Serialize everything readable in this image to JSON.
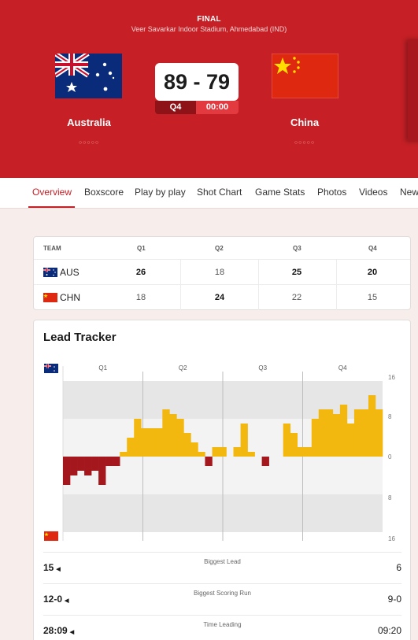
{
  "header": {
    "stage": "FINAL",
    "venue": "Veer Savarkar Indoor Stadium, Ahmedabad (IND)",
    "home_team": "Australia",
    "away_team": "China",
    "score": "89 - 79",
    "period": "Q4",
    "clock": "00:00",
    "dots": "○○○○○"
  },
  "tabs": [
    "Overview",
    "Boxscore",
    "Play by play",
    "Shot Chart",
    "Game Stats",
    "Photos",
    "Videos",
    "New"
  ],
  "quarters": {
    "headers": [
      "TEAM",
      "Q1",
      "Q2",
      "Q3",
      "Q4"
    ],
    "rows": [
      {
        "team": "AUS",
        "scores": [
          "26",
          "18",
          "25",
          "20"
        ],
        "bold": [
          true,
          false,
          true,
          true
        ]
      },
      {
        "team": "CHN",
        "scores": [
          "18",
          "24",
          "22",
          "15"
        ],
        "bold": [
          false,
          true,
          false,
          false
        ]
      }
    ]
  },
  "lead_tracker": {
    "title": "Lead Tracker",
    "stats": [
      {
        "home": "15",
        "label": "Biggest Lead",
        "away": "6"
      },
      {
        "home": "12-0",
        "label": "Biggest Scoring Run",
        "away": "9-0"
      },
      {
        "home": "28:09",
        "label": "Time Leading",
        "away": "09:20"
      }
    ]
  },
  "chart_data": {
    "type": "bar",
    "title": "",
    "quarters": [
      "Q1",
      "Q2",
      "Q3",
      "Q4"
    ],
    "y_ticks": [
      "16",
      "8",
      "0",
      "8",
      "16"
    ],
    "ylim": [
      -16,
      16
    ],
    "note": "positive = Australia lead, negative = China lead",
    "values": [
      -6,
      -4,
      -3,
      -4,
      -3,
      -6,
      -2,
      -2,
      1,
      4,
      8,
      6,
      6,
      6,
      10,
      9,
      8,
      5,
      3,
      1,
      -2,
      2,
      2,
      0,
      2,
      7,
      1,
      0,
      -2,
      0,
      0,
      7,
      5,
      2,
      2,
      8,
      10,
      10,
      9,
      11,
      7,
      10,
      10,
      13,
      10
    ],
    "colors": {
      "home": "#f2b80f",
      "away": "#a3171d"
    }
  },
  "colors": {
    "brand": "#c62026",
    "accent_dark": "#8e1318"
  }
}
